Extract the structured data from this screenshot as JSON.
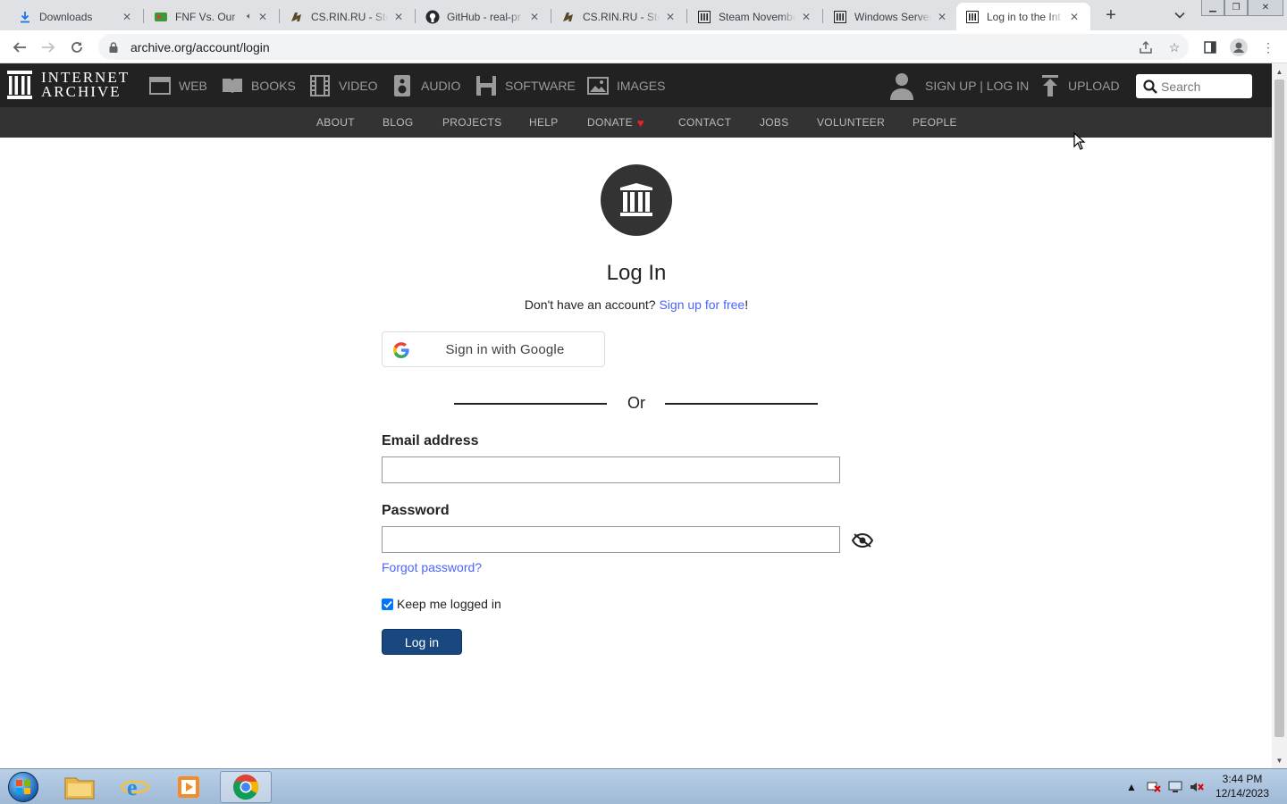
{
  "browser": {
    "tabs": [
      {
        "title": "Downloads",
        "icon": "download-icon",
        "active": false
      },
      {
        "title": "FNF Vs. Our",
        "icon": "game-favicon",
        "active": false,
        "audio": true
      },
      {
        "title": "CS.RIN.RU - Stea",
        "icon": "csrin-favicon",
        "active": false
      },
      {
        "title": "GitHub - real-pr",
        "icon": "github-icon",
        "active": false
      },
      {
        "title": "CS.RIN.RU - Ste",
        "icon": "csrin-favicon",
        "active": false
      },
      {
        "title": "Steam Novembe",
        "icon": "archive-favicon",
        "active": false
      },
      {
        "title": "Windows Server",
        "icon": "archive-favicon",
        "active": false
      },
      {
        "title": "Log in to the Int",
        "icon": "archive-favicon",
        "active": true
      }
    ],
    "url": "archive.org/account/login"
  },
  "ia_nav": {
    "logo_line1": "INTERNET",
    "logo_line2": "ARCHIVE",
    "media": [
      {
        "label": "WEB",
        "icon": "web-icon"
      },
      {
        "label": "BOOKS",
        "icon": "books-icon"
      },
      {
        "label": "VIDEO",
        "icon": "video-icon"
      },
      {
        "label": "AUDIO",
        "icon": "audio-icon"
      },
      {
        "label": "SOFTWARE",
        "icon": "software-icon"
      },
      {
        "label": "IMAGES",
        "icon": "images-icon"
      }
    ],
    "user_label": "SIGN UP | LOG IN",
    "upload_label": "UPLOAD",
    "search_placeholder": "Search"
  },
  "subnav": {
    "items": [
      "ABOUT",
      "BLOG",
      "PROJECTS",
      "HELP",
      "DONATE",
      "CONTACT",
      "JOBS",
      "VOLUNTEER",
      "PEOPLE"
    ],
    "donate_heart": "♥",
    "heart_color": "#ea2226"
  },
  "login": {
    "title": "Log In",
    "no_account_text": "Don't have an account? ",
    "signup_link": "Sign up for free",
    "signup_suffix": "!",
    "google_button": "Sign in with Google",
    "or_text": "Or",
    "email_label": "Email address",
    "email_value": "",
    "password_label": "Password",
    "password_value": "",
    "forgot_link": "Forgot password?",
    "remember_label": "Keep me logged in",
    "remember_checked": true,
    "submit_label": "Log in",
    "link_color": "#4b64ff",
    "button_color": "#194880"
  },
  "taskbar": {
    "time": "3:44 PM",
    "date": "12/14/2023",
    "apps": [
      "file-explorer-icon",
      "internet-explorer-icon",
      "media-player-icon",
      "chrome-icon"
    ]
  }
}
